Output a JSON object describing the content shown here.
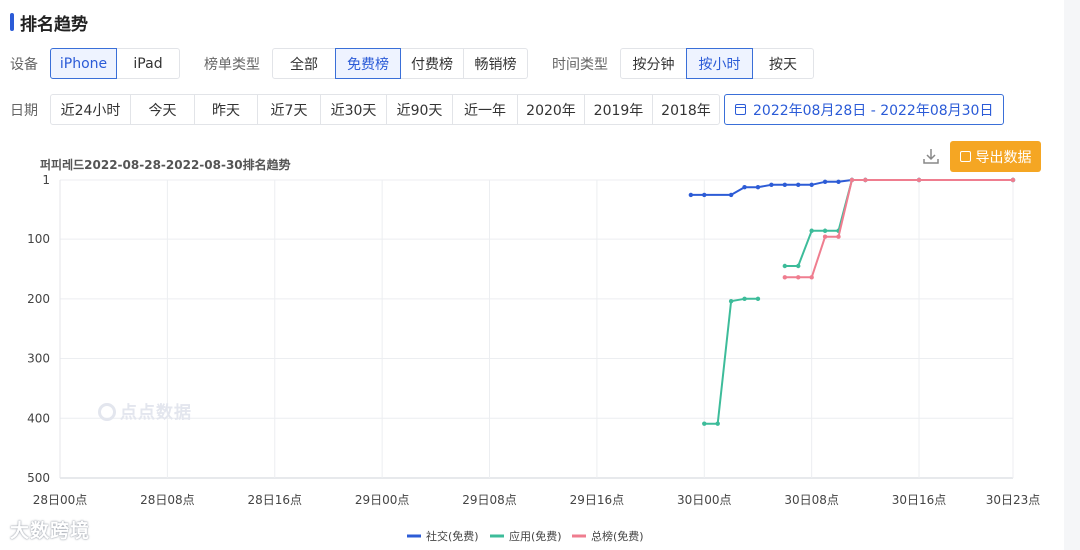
{
  "section_title": "排名趋势",
  "filters": {
    "device": {
      "label": "设备",
      "options": [
        "iPhone",
        "iPad"
      ],
      "active": 0
    },
    "list_type": {
      "label": "榜单类型",
      "options": [
        "全部",
        "免费榜",
        "付费榜",
        "畅销榜"
      ],
      "active": 1
    },
    "time_type": {
      "label": "时间类型",
      "options": [
        "按分钟",
        "按小时",
        "按天"
      ],
      "active": 1
    },
    "date": {
      "label": "日期",
      "options": [
        "近24小时",
        "今天",
        "昨天",
        "近7天",
        "近30天",
        "近90天",
        "近一年",
        "2020年",
        "2019年",
        "2018年"
      ],
      "range": "2022年08月28日 - 2022年08月30日"
    }
  },
  "toolbar": {
    "download_icon": "download-icon",
    "export_label": "导出数据",
    "export_icon": "external-link-icon"
  },
  "watermark": "点点数据",
  "brand": "大数跨境",
  "colors": {
    "accent": "#2b5bd7",
    "export": "#f5a623"
  },
  "chart_data": {
    "type": "line",
    "title": "퍼피레드2022-08-28-2022-08-30排名趋势",
    "y_inverted": true,
    "ylim": [
      1,
      500
    ],
    "y_ticks": [
      1,
      100,
      200,
      300,
      400,
      500
    ],
    "x_range": [
      0,
      71
    ],
    "x_ticks": [
      {
        "x": 0,
        "label": "28日00点"
      },
      {
        "x": 8,
        "label": "28日08点"
      },
      {
        "x": 16,
        "label": "28日16点"
      },
      {
        "x": 24,
        "label": "29日00点"
      },
      {
        "x": 32,
        "label": "29日08点"
      },
      {
        "x": 40,
        "label": "29日16点"
      },
      {
        "x": 48,
        "label": "30日00点"
      },
      {
        "x": 56,
        "label": "30日08点"
      },
      {
        "x": 64,
        "label": "30日16点"
      },
      {
        "x": 71,
        "label": "30日23点"
      }
    ],
    "grid": true,
    "legend_position": "bottom-center",
    "series": [
      {
        "name": "社交(免费)",
        "color": "#2d5cd6",
        "points": [
          [
            47,
            26
          ],
          [
            48,
            26
          ],
          [
            50,
            26
          ],
          [
            51,
            13
          ],
          [
            52,
            13
          ],
          [
            53,
            9
          ],
          [
            54,
            9
          ],
          [
            55,
            9
          ],
          [
            56,
            9
          ],
          [
            57,
            4
          ],
          [
            58,
            4
          ],
          [
            59,
            1
          ],
          [
            60,
            1
          ],
          [
            64,
            1
          ],
          [
            71,
            1
          ]
        ]
      },
      {
        "name": "应用(免费)",
        "color": "#3dbc9a",
        "points": [
          [
            48,
            409
          ],
          [
            49,
            409
          ],
          [
            50,
            204
          ],
          [
            51,
            200
          ],
          [
            52,
            200
          ]
        ]
      },
      {
        "name": "应用(免费)",
        "color": "#3dbc9a",
        "points": [
          [
            54,
            145
          ],
          [
            55,
            145
          ],
          [
            56,
            86
          ],
          [
            57,
            86
          ],
          [
            58,
            86
          ],
          [
            59,
            1
          ],
          [
            60,
            1
          ],
          [
            64,
            1
          ],
          [
            71,
            1
          ]
        ]
      },
      {
        "name": "总榜(免费)",
        "color": "#ef7d8f",
        "points": [
          [
            54,
            164
          ],
          [
            55,
            164
          ],
          [
            56,
            164
          ],
          [
            57,
            96
          ],
          [
            58,
            96
          ],
          [
            59,
            1
          ],
          [
            60,
            1
          ],
          [
            64,
            1
          ],
          [
            71,
            1
          ]
        ]
      }
    ],
    "legend": [
      {
        "name": "社交(免费)",
        "color": "#2d5cd6"
      },
      {
        "name": "应用(免费)",
        "color": "#3dbc9a"
      },
      {
        "name": "总榜(免费)",
        "color": "#ef7d8f"
      }
    ]
  }
}
